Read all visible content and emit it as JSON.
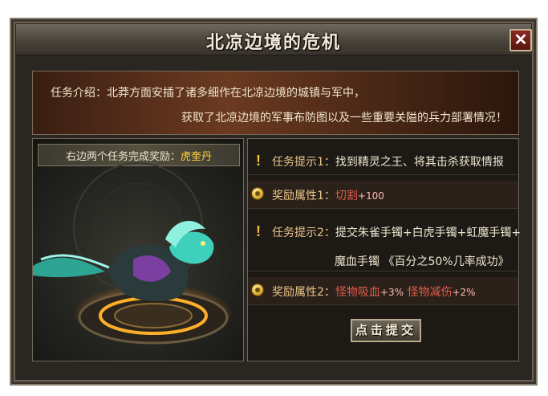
{
  "window": {
    "title": "北凉边境的危机",
    "close_label": "✕"
  },
  "intro": {
    "line1": "任务介绍：北莽方面安插了诸多细作在北凉边境的城镇与军中，",
    "line2": "获取了北凉边境的军事布防图以及一些重要关隘的兵力部署情况！"
  },
  "reward_panel": {
    "prefix": "右边两个任务完成奖励：",
    "item": "虎奎丹"
  },
  "tasks": [
    {
      "type": "hint",
      "label": "任务提示1：",
      "text": "找到精灵之王、将其击杀获取情报"
    },
    {
      "type": "reward",
      "label": "奖励属性1：",
      "stat1_name": "切割",
      "stat1_value": "+100"
    },
    {
      "type": "hint",
      "label": "任务提示2：",
      "text_line1": "提交朱雀手镯+白虎手镯+虹魔手镯+",
      "text_line2": "魔血手镯 《百分之50%几率成功》"
    },
    {
      "type": "reward",
      "label": "奖励属性2：",
      "stat1_name": "怪物吸血",
      "stat1_value": "+3%",
      "stat2_name": "怪物减伤",
      "stat2_value": "+2%"
    }
  ],
  "submit_label": "点击提交",
  "colors": {
    "accent_gold": "#ffd13a",
    "stat_red": "#e25b4a"
  }
}
